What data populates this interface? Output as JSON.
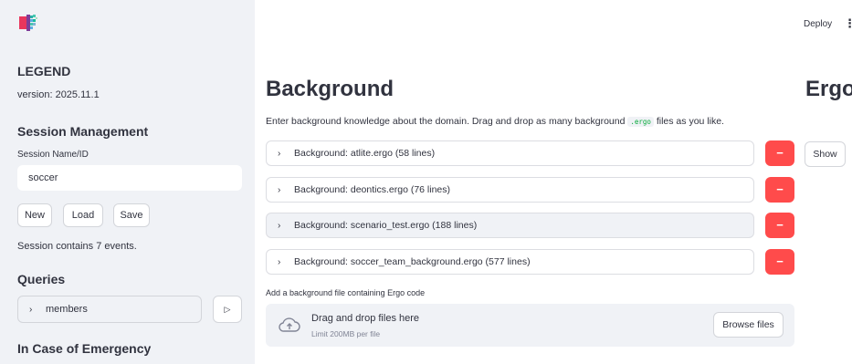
{
  "app": {
    "deploy_label": "Deploy",
    "menu_glyph": "⋮"
  },
  "sidebar": {
    "legend_heading": "LEGEND",
    "version": "version: 2025.11.1",
    "session_heading": "Session Management",
    "session_label": "Session Name/ID",
    "session_value": "soccer",
    "buttons": {
      "new": "New",
      "load": "Load",
      "save": "Save"
    },
    "session_status": "Session contains 7 events.",
    "queries_heading": "Queries",
    "query_item": "members",
    "run_glyph": "▷",
    "emergency_heading": "In Case of Emergency"
  },
  "main": {
    "title": "Background",
    "description_pre": "Enter background knowledge about the domain. Drag and drop as many background",
    "description_code": ".ergo",
    "description_post": "files as you like.",
    "expanders": [
      {
        "label": "Background: atlite.ergo (58 lines)"
      },
      {
        "label": "Background: deontics.ergo (76 lines)"
      },
      {
        "label": "Background: scenario_test.ergo (188 lines)"
      },
      {
        "label": "Background: soccer_team_background.ergo (577 lines)"
      }
    ],
    "remove_glyph": "−",
    "chevron_glyph": "›",
    "upload": {
      "label": "Add a background file containing Ergo code",
      "drop_title": "Drag and drop files here",
      "limit": "Limit 200MB per file",
      "browse_label": "Browse files"
    }
  },
  "ergo": {
    "title": "Ergo",
    "show_label": "Show"
  },
  "colors": {
    "sidebar_bg": "#f0f2f6",
    "danger": "#ff4b4b",
    "text": "#31333f",
    "code_green": "#09ab3b"
  }
}
